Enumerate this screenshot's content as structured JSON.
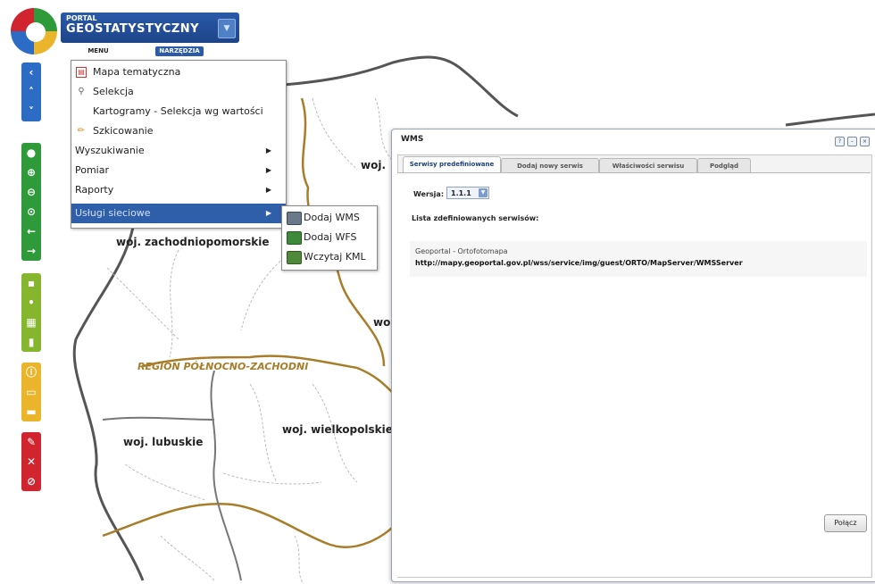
{
  "header": {
    "portal_small": "PORTAL",
    "portal_big": "GEOSTATYSTYCZNY",
    "tab_menu": "MENU",
    "tab_narzedzia": "NARZĘDZIA"
  },
  "map": {
    "labels": {
      "zachodniopomorskie": "woj. zachodniopomorskie",
      "lubuskie": "woj. lubuskie",
      "wielkopolskie": "woj. wielkopolskie",
      "woj_partial_1": "woj.",
      "woj_partial_2": "wo"
    },
    "region_label": "REGION PÓŁNOCNO-ZACHODNI"
  },
  "menu": {
    "items": [
      {
        "label": "Mapa tematyczna",
        "icon": "map-doc-icon"
      },
      {
        "label": "Selekcja",
        "icon": "magnifier-icon"
      },
      {
        "label": "Kartogramy - Selekcja wg wartości"
      },
      {
        "label": "Szkicowanie",
        "icon": "pencil-icon"
      },
      {
        "label": "Wyszukiwanie",
        "submenu": true
      },
      {
        "label": "Pomiar",
        "submenu": true
      },
      {
        "label": "Raporty",
        "submenu": true
      },
      {
        "label": "Usługi sieciowe",
        "submenu": true,
        "active": true
      }
    ]
  },
  "submenu": {
    "items": [
      {
        "label": "Dodaj WMS",
        "icon": "printer-icon"
      },
      {
        "label": "Dodaj WFS",
        "icon": "layers-icon"
      },
      {
        "label": "Wczytaj KML",
        "icon": "kml-icon"
      }
    ]
  },
  "wms": {
    "title": "WMS",
    "tabs": [
      "Serwisy predefiniowane",
      "Dodaj nowy serwis",
      "Właściwości serwisu",
      "Podgląd"
    ],
    "version_label": "Wersja:",
    "version_value": "1.1.1",
    "list_label": "Lista zdefiniowanych serwisów:",
    "service_name": "Geoportal - Ortofotomapa",
    "service_url": "http://mapy.geoportal.gov.pl/wss/service/img/guest/ORTO/MapServer/WMSServer",
    "connect_button": "Połącz"
  },
  "colors": {
    "header_blue": "#2a5aa8",
    "menu_active": "#2f5fa8",
    "border_gold": "#a87d2a",
    "toolbar_blue": "#2d6cc4",
    "toolbar_green": "#2f9a3a",
    "toolbar_lightgreen": "#86b52e",
    "toolbar_yellow": "#eab52a",
    "toolbar_red": "#d0252e"
  }
}
